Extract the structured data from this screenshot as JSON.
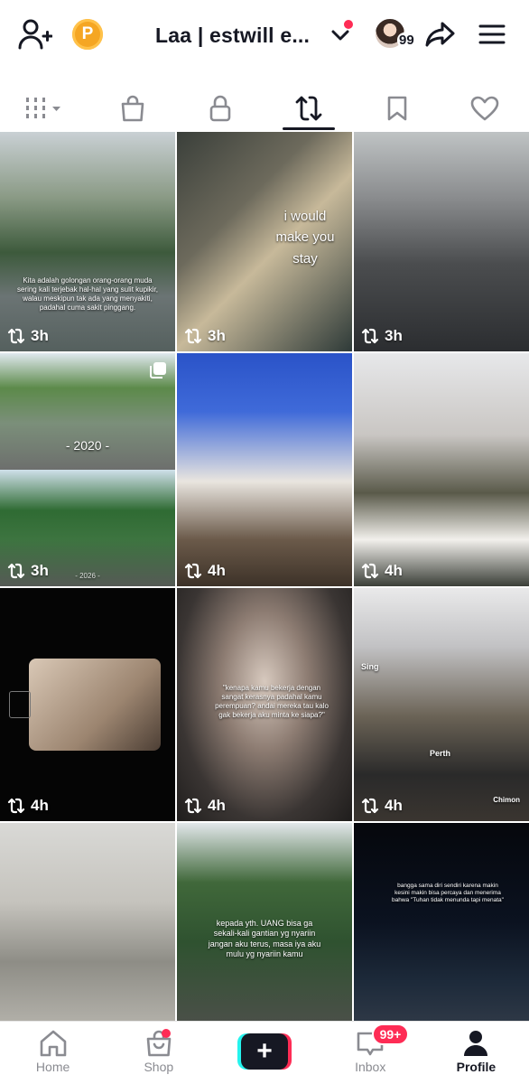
{
  "header": {
    "title": "Laa | estwill e...",
    "coin_letter": "P",
    "avatar_count": "99",
    "icons": [
      "add-user-icon",
      "coin-icon",
      "chevron-down-icon",
      "share-icon",
      "menu-icon"
    ]
  },
  "tabs": [
    {
      "name": "grid-filter",
      "icon": "grid-filter-icon"
    },
    {
      "name": "shop",
      "icon": "shopping-bag-icon"
    },
    {
      "name": "private",
      "icon": "lock-icon"
    },
    {
      "name": "reposts",
      "icon": "repost-icon",
      "active": true
    },
    {
      "name": "favorites",
      "icon": "bookmark-icon"
    },
    {
      "name": "liked",
      "icon": "heart-icon"
    }
  ],
  "tiles": [
    {
      "time": "3h",
      "caption": "Kita adalah golongan orang-orang muda sering kali terjebak hal-hal yang sulit kupikir, walau meskipun tak ada yang menyakiti, padahal cuma sakit pinggang."
    },
    {
      "time": "3h",
      "caption": "i would make you stay"
    },
    {
      "time": "3h",
      "caption": ""
    },
    {
      "time": "3h",
      "caption": "- 2020 -",
      "caption2": "- 2026 -"
    },
    {
      "time": "4h",
      "caption": ""
    },
    {
      "time": "4h",
      "caption": ""
    },
    {
      "time": "4h",
      "caption": ""
    },
    {
      "time": "4h",
      "caption": "\"kenapa kamu bekerja dengan sangat kerasnya padahal kamu perempuan? andai mereka tau kalo gak bekerja aku minta ke siapa?\""
    },
    {
      "time": "4h",
      "caption": "Sing",
      "caption2": "Perth",
      "caption3": "Chimon"
    },
    {
      "time": "",
      "caption": ""
    },
    {
      "time": "",
      "caption": "kepada yth. UANG bisa ga sekali-kali gantian yg nyariin jangan aku terus, masa iya aku mulu yg nyariin kamu"
    },
    {
      "time": "",
      "caption": "bangga sama diri sendiri karena makin kesini makin bisa percaya dan menerima bahwa \"Tuhan tidak menunda tapi menata\""
    }
  ],
  "nav": {
    "home": "Home",
    "shop": "Shop",
    "inbox": "Inbox",
    "inbox_badge": "99+",
    "profile": "Profile"
  },
  "colors": {
    "accent_red": "#fe2c55",
    "accent_cyan": "#25f4ee",
    "text_dark": "#161823",
    "coin": "#f5a623"
  }
}
